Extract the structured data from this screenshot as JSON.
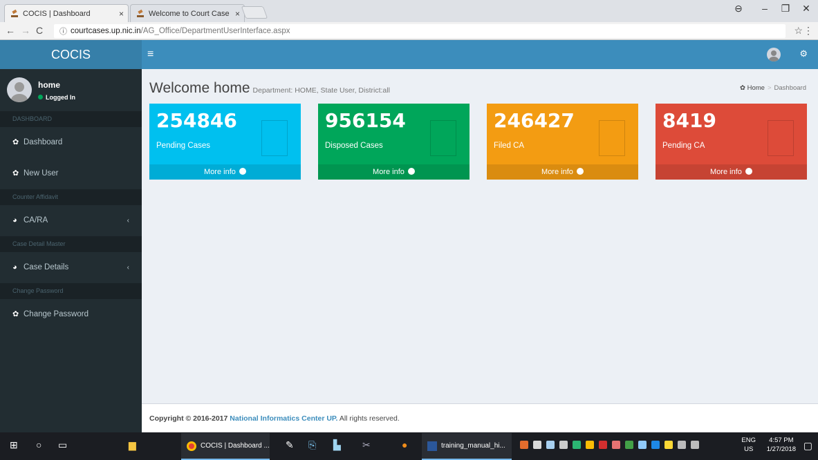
{
  "browser": {
    "tabs": [
      {
        "title": "COCIS | Dashboard",
        "close": "×"
      },
      {
        "title": "Welcome to Court Case",
        "close": "×"
      }
    ],
    "url_domain": "courtcases.up.nic.in",
    "url_path": "/AG_Office/DepartmentUserInterface.aspx"
  },
  "header": {
    "logo": "COCIS",
    "menu_icon": "≡"
  },
  "sidebar": {
    "user": {
      "name": "home",
      "status": "Logged In"
    },
    "sections": [
      {
        "header": "DASHBOARD",
        "items": [
          {
            "label": "Dashboard"
          },
          {
            "label": "New User"
          }
        ]
      },
      {
        "header": "Counter Affidavit",
        "items": [
          {
            "label": "CA/RA"
          }
        ]
      },
      {
        "header": "Case Detail Master",
        "items": [
          {
            "label": "Case Details"
          }
        ]
      },
      {
        "header": "Change Password",
        "items": [
          {
            "label": "Change Password"
          }
        ]
      }
    ]
  },
  "main": {
    "title": "Welcome home",
    "subtitle": "Department: HOME, State User, District:all",
    "breadcrumb": {
      "home": "Home",
      "current": "Dashboard"
    },
    "boxes": [
      {
        "value": "254846",
        "label": "Pending Cases",
        "more": "More info",
        "color": "#00c0ef"
      },
      {
        "value": "956154",
        "label": "Disposed Cases",
        "more": "More info",
        "color": "#00a65a"
      },
      {
        "value": "246427",
        "label": "Filed CA",
        "more": "More info",
        "color": "#f39c12"
      },
      {
        "value": "8419",
        "label": "Pending CA",
        "more": "More info",
        "color": "#dd4b39"
      }
    ]
  },
  "footer": {
    "copyright": "Copyright © 2016-2017",
    "org": "National Informatics Center UP.",
    "rights": "All rights reserved."
  },
  "taskbar": {
    "apps": [
      {
        "label": "COCIS | Dashboard ..."
      },
      {
        "label": "training_manual_hi..."
      }
    ],
    "lang_top": "ENG",
    "lang_bottom": "US",
    "time": "4:57 PM",
    "date": "1/27/2018"
  },
  "colors": {
    "header": "#3c8dbc",
    "logo_bg": "#367fa9",
    "sidebar": "#222d32"
  }
}
